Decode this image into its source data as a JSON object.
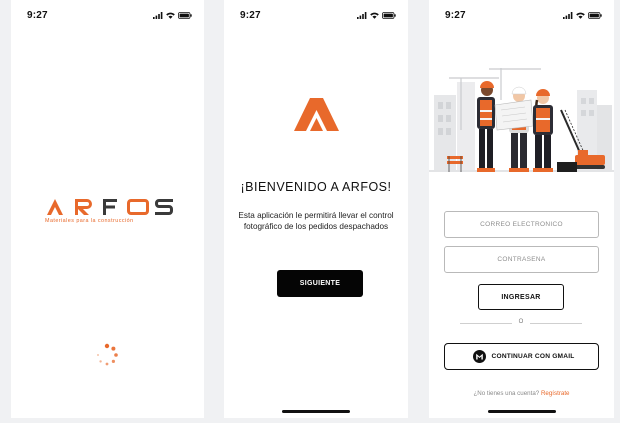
{
  "status_bar": {
    "time": "9:27"
  },
  "splash": {
    "brand": "ARFOS",
    "tagline": "Materiales para la construcción",
    "colors": {
      "brand_orange": "#e8692b",
      "brand_dark": "#3a3a3a"
    }
  },
  "welcome": {
    "title": "¡BIENVENIDO A ARFOS!",
    "description": "Esta aplicación le permitirá llevar el control fotográfico de los pedidos despachados",
    "next_button": "SIGUIENTE"
  },
  "login": {
    "email_placeholder": "CORREO ELECTRÓNICO",
    "password_placeholder": "CONTRASEÑA",
    "login_button": "INGRESAR",
    "separator": "O",
    "gmail_button": "CONTINUAR CON GMAIL",
    "signup_prompt": "¿No tienes una cuenta?",
    "signup_link": "Regístrate"
  }
}
